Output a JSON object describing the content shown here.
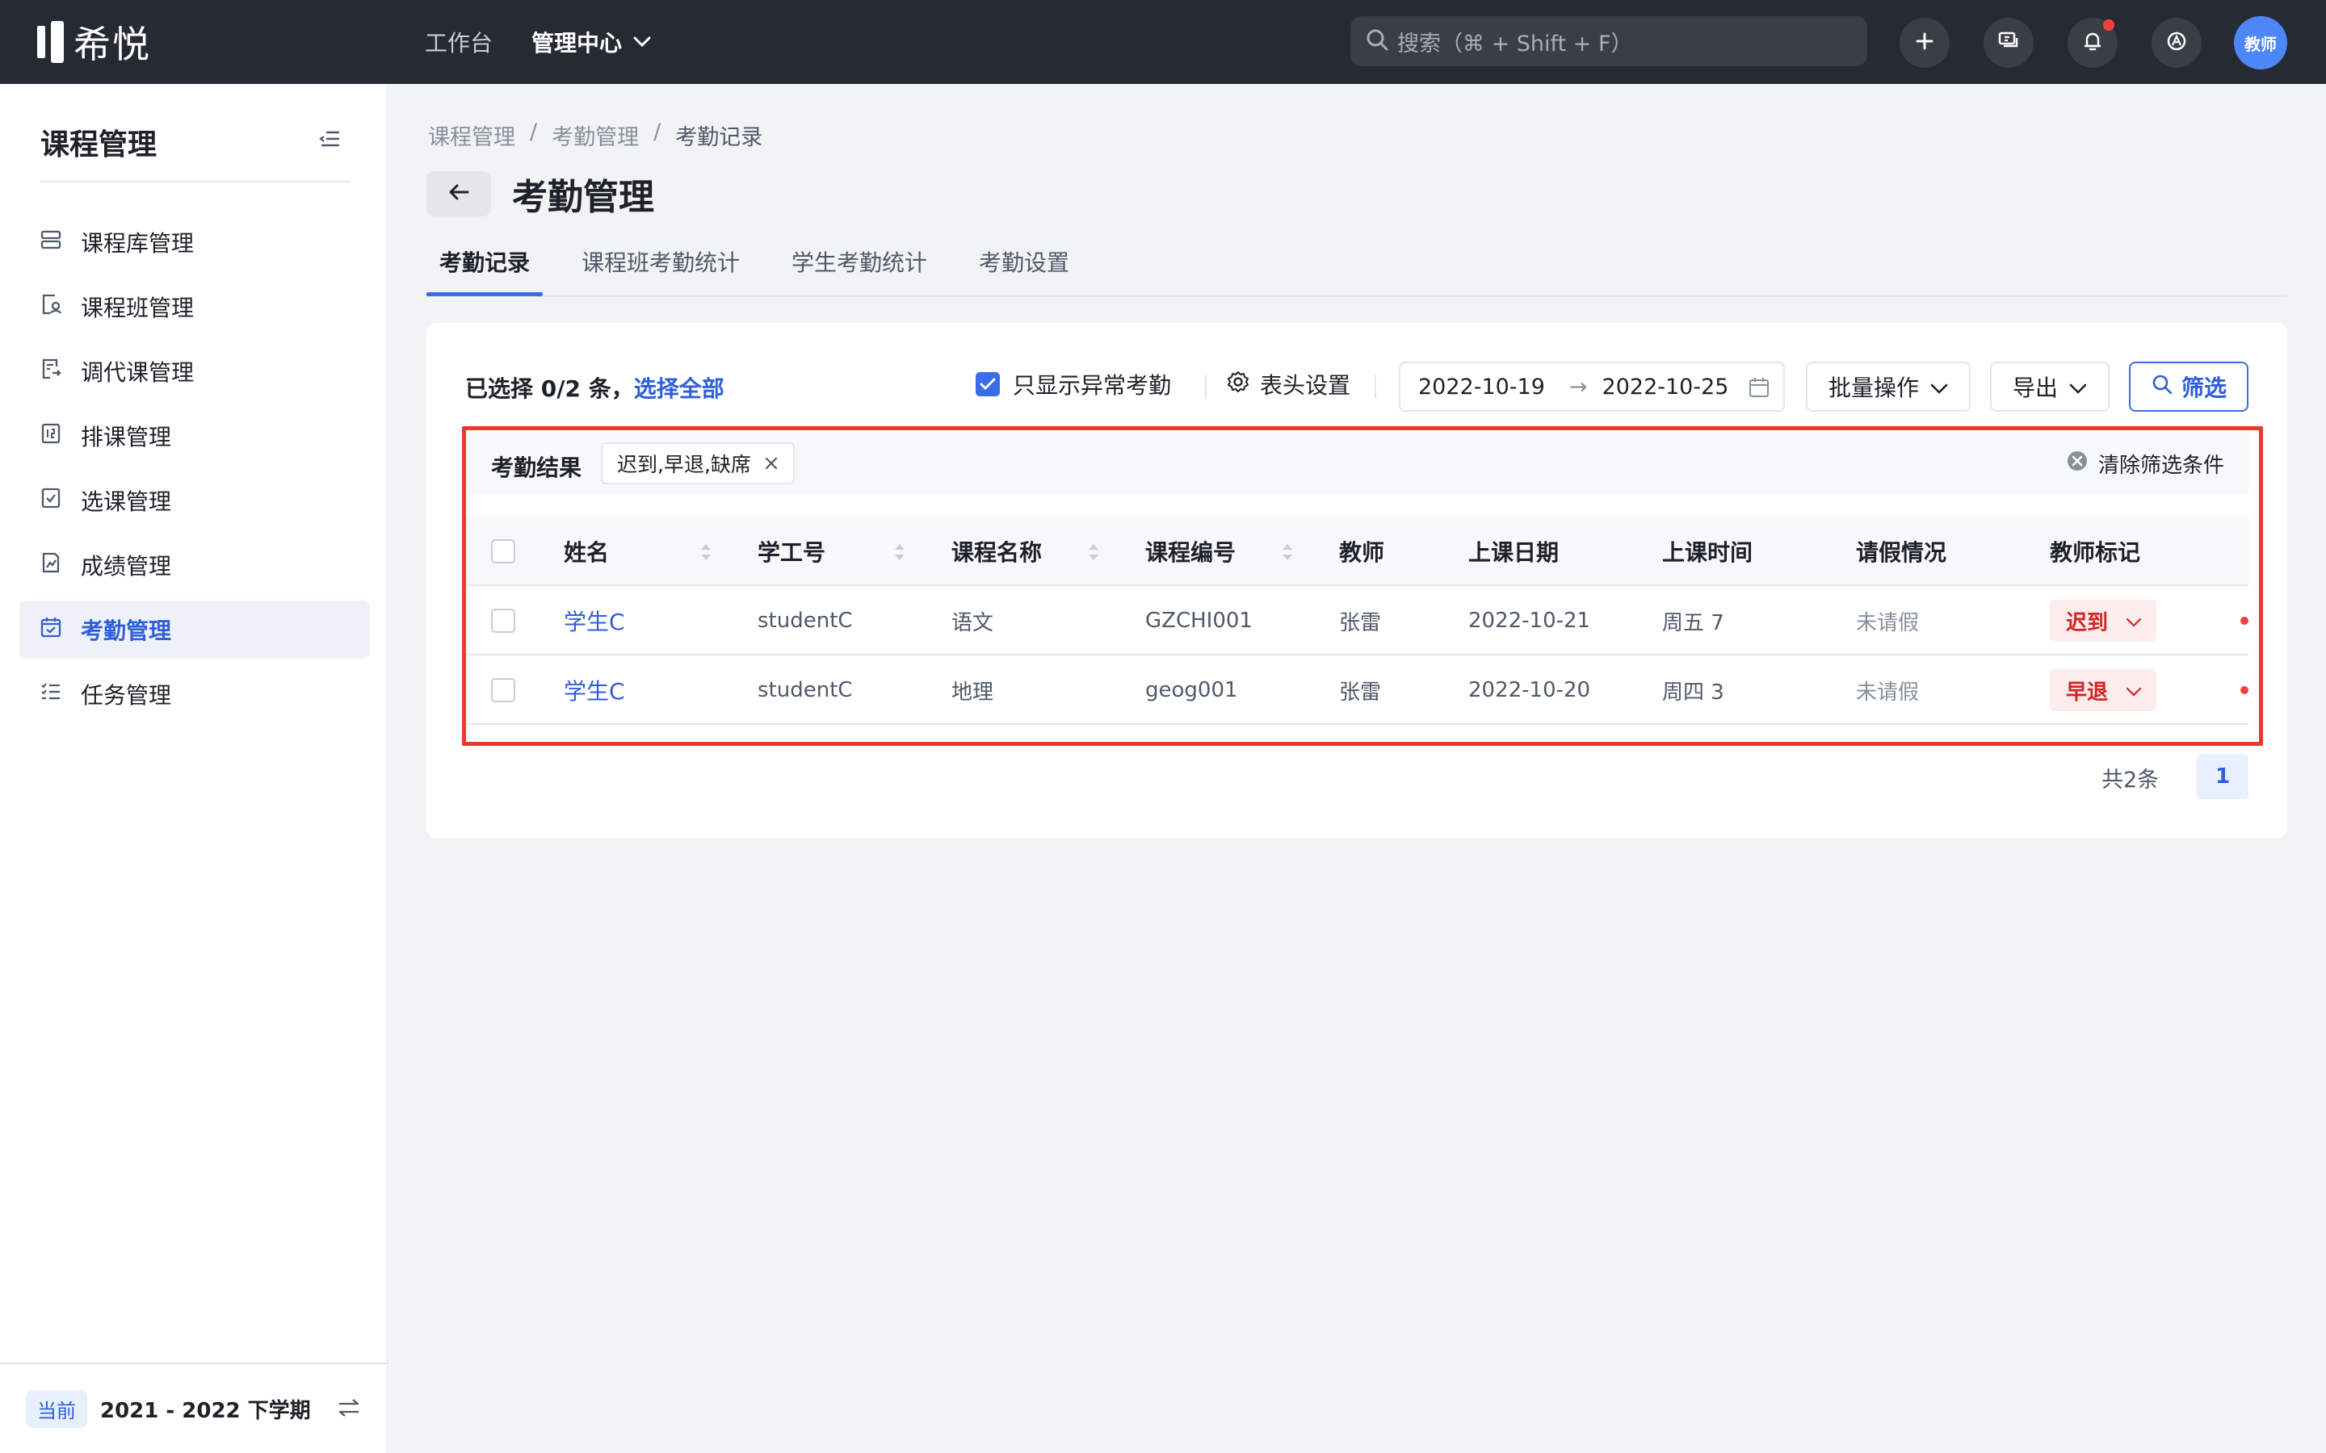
{
  "app": {
    "logo_text": "希悦"
  },
  "topnav": {
    "items": [
      "工作台",
      "管理中心"
    ]
  },
  "search": {
    "placeholder": "搜索（⌘ + Shift + F）"
  },
  "user": {
    "avatar_text": "教师"
  },
  "sidebar": {
    "title": "课程管理",
    "items": [
      {
        "label": "课程库管理",
        "icon": "database-icon"
      },
      {
        "label": "课程班管理",
        "icon": "class-icon"
      },
      {
        "label": "调代课管理",
        "icon": "substitute-icon"
      },
      {
        "label": "排课管理",
        "icon": "schedule-icon"
      },
      {
        "label": "选课管理",
        "icon": "checklist-icon"
      },
      {
        "label": "成绩管理",
        "icon": "grades-icon"
      },
      {
        "label": "考勤管理",
        "icon": "calendar-check-icon",
        "active": true
      },
      {
        "label": "任务管理",
        "icon": "task-list-icon"
      }
    ],
    "term_badge": "当前",
    "term_text": "2021 - 2022 下学期"
  },
  "breadcrumb": [
    "课程管理",
    "/",
    "考勤管理",
    "/",
    "考勤记录"
  ],
  "page": {
    "title": "考勤管理"
  },
  "tabs": [
    "考勤记录",
    "课程班考勤统计",
    "学生考勤统计",
    "考勤设置"
  ],
  "toolbar": {
    "selected_text": "已选择 0/2 条，",
    "select_all": "选择全部",
    "only_abnormal": "只显示异常考勤",
    "header_settings": "表头设置",
    "date_start": "2022-10-19",
    "date_arrow": "→",
    "date_end": "2022-10-25",
    "batch": "批量操作",
    "export": "导出",
    "filter": "筛选"
  },
  "filter_bar": {
    "label": "考勤结果",
    "tag": "迟到,早退,缺席",
    "clear": "清除筛选条件"
  },
  "table": {
    "columns": [
      "姓名",
      "学工号",
      "课程名称",
      "课程编号",
      "教师",
      "上课日期",
      "上课时间",
      "请假情况",
      "教师标记"
    ],
    "rows": [
      [
        "学生C",
        "studentC",
        "语文",
        "GZCHI001",
        "张雷",
        "2022-10-21",
        "周五 7",
        "未请假",
        "迟到"
      ],
      [
        "学生C",
        "studentC",
        "地理",
        "geog001",
        "张雷",
        "2022-10-20",
        "周四 3",
        "未请假",
        "早退"
      ]
    ]
  },
  "pagination": {
    "total": "共2条",
    "current": "1"
  },
  "colors": {
    "accent": "#3a6ee8",
    "topbar": "#262a32",
    "highlight_frame": "#e8392c",
    "tag_red": "#d32424"
  }
}
